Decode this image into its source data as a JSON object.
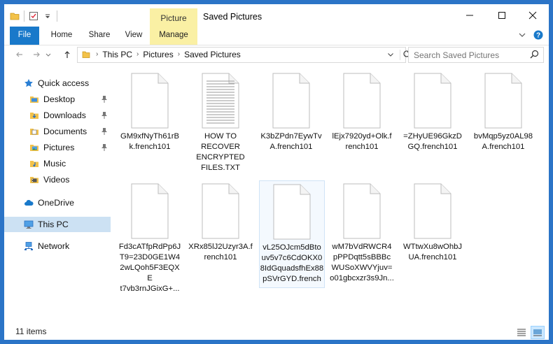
{
  "window": {
    "title": "Saved Pictures",
    "context_tab": "Picture Tools"
  },
  "ribbon": {
    "tabs": [
      "File",
      "Home",
      "Share",
      "View",
      "Manage"
    ]
  },
  "address": {
    "crumbs": [
      "This PC",
      "Pictures",
      "Saved Pictures"
    ]
  },
  "search": {
    "placeholder": "Search Saved Pictures"
  },
  "navpane": {
    "quick_access": "Quick access",
    "items": [
      {
        "label": "Desktop",
        "icon": "desktop-folder-icon",
        "pinned": true
      },
      {
        "label": "Downloads",
        "icon": "downloads-folder-icon",
        "pinned": true
      },
      {
        "label": "Documents",
        "icon": "documents-folder-icon",
        "pinned": true
      },
      {
        "label": "Pictures",
        "icon": "pictures-folder-icon",
        "pinned": true
      },
      {
        "label": "Music",
        "icon": "music-folder-icon",
        "pinned": false
      },
      {
        "label": "Videos",
        "icon": "videos-folder-icon",
        "pinned": false
      }
    ],
    "onedrive": "OneDrive",
    "thispc": "This PC",
    "network": "Network"
  },
  "files": [
    {
      "name": "GM9xfNyTh61rBk.french101",
      "lines": [
        "GM9xfNyTh61rB",
        "k.french101"
      ],
      "type": "blank"
    },
    {
      "name": "HOW TO RECOVER ENCRYPTED FILES.TXT",
      "lines": [
        "HOW TO",
        "RECOVER",
        "ENCRYPTED",
        "FILES.TXT"
      ],
      "type": "text"
    },
    {
      "name": "K3bZPdn7EywTvA.french101",
      "lines": [
        "K3bZPdn7EywTv",
        "A.french101"
      ],
      "type": "blank"
    },
    {
      "name": "lEjx7920yd+Olk.french101",
      "lines": [
        "lEjx7920yd+Olk.f",
        "rench101"
      ],
      "type": "blank"
    },
    {
      "name": "=ZHyUE96GkzDGQ.french101",
      "lines": [
        "=ZHyUE96GkzD",
        "GQ.french101"
      ],
      "type": "blank"
    },
    {
      "name": "bvMqp5yz0AL98A.french101",
      "lines": [
        "bvMqp5yz0AL98",
        "A.french101"
      ],
      "type": "blank"
    },
    {
      "name": "Fd3cATfpRdPp6JT9=23D0GE1W42wLQoh5F3EQXEt7vb3rnJGixG+...",
      "lines": [
        "Fd3cATfpRdPp6J",
        "T9=23D0GE1W4",
        "2wLQoh5F3EQXE",
        "t7vb3rnJGixG+..."
      ],
      "type": "blank"
    },
    {
      "name": "XRx85lJ2Uzyr3A.french101",
      "lines": [
        "XRx85lJ2Uzyr3A.f",
        "rench101"
      ],
      "type": "blank"
    },
    {
      "name": "vL25OJcm5dBtouv5v7c6CdOKX08IdGquadsfhEx88pSVrGYD.french",
      "lines": [
        "vL25OJcm5dBto",
        "uv5v7c6CdOKX0",
        "8IdGquadsfhEx88",
        "pSVrGYD.french"
      ],
      "type": "blank"
    },
    {
      "name": "wM7bVdRWCR4pPPDqtt5sBBBcWUSoXWVYjuv=o01gbcxzr3s9Jn...",
      "lines": [
        "wM7bVdRWCR4",
        "pPPDqtt5sBBBc",
        "WUSoXWVYjuv=",
        "o01gbcxzr3s9Jn..."
      ],
      "type": "blank"
    },
    {
      "name": "WTtwXu8wOhbJUA.french101",
      "lines": [
        "WTtwXu8wOhbJ",
        "UA.french101"
      ],
      "type": "blank"
    }
  ],
  "status": {
    "count": "11 items"
  },
  "colors": {
    "accent": "#1979ca",
    "context_tab": "#faf0a4",
    "selection": "#cce1f3",
    "frame": "#2b74c7"
  },
  "icons": {
    "qat": [
      "folder-icon",
      "properties-check-icon",
      "customize-dropdown-icon"
    ],
    "controls": [
      "minimize-icon",
      "maximize-icon",
      "close-icon"
    ]
  }
}
